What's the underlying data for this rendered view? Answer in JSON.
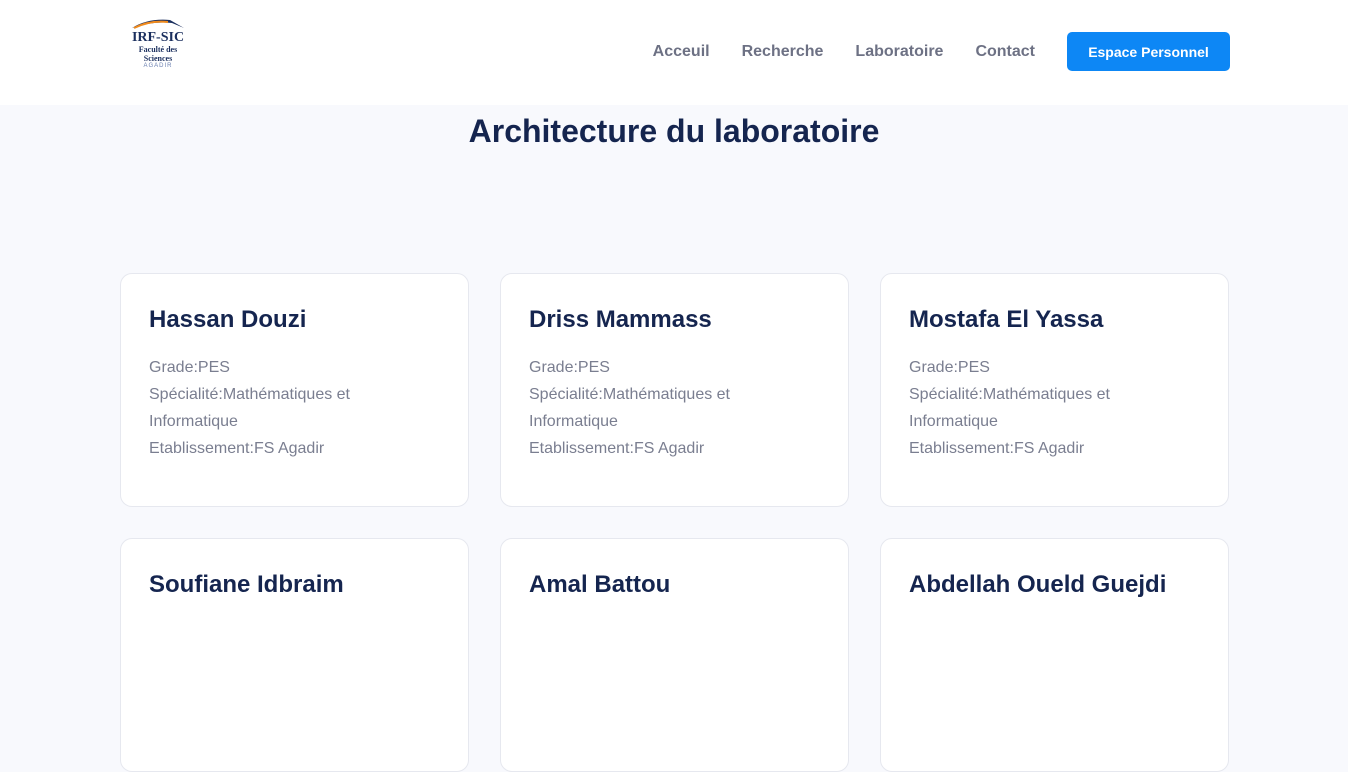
{
  "logo": {
    "title": "IRF-SIC",
    "line1": "Faculté des",
    "line2": "Sciences",
    "line3": "AGADIR"
  },
  "nav": [
    "Acceuil",
    "Recherche",
    "Laboratoire",
    "Contact"
  ],
  "cta": "Espace Personnel",
  "page_title": "Architecture du laboratoire",
  "members": [
    {
      "name": "Hassan Douzi",
      "grade": "Grade:PES",
      "speciality": "Spécialité:Mathématiques et Informatique",
      "institution": "Etablissement:FS Agadir"
    },
    {
      "name": "Driss Mammass",
      "grade": "Grade:PES",
      "speciality": "Spécialité:Mathématiques et Informatique",
      "institution": "Etablissement:FS Agadir"
    },
    {
      "name": "Mostafa El Yassa",
      "grade": "Grade:PES",
      "speciality": "Spécialité:Mathématiques et Informatique",
      "institution": "Etablissement:FS Agadir"
    },
    {
      "name": "Soufiane Idbraim"
    },
    {
      "name": "Amal Battou"
    },
    {
      "name": "Abdellah Oueld Guejdi"
    }
  ]
}
